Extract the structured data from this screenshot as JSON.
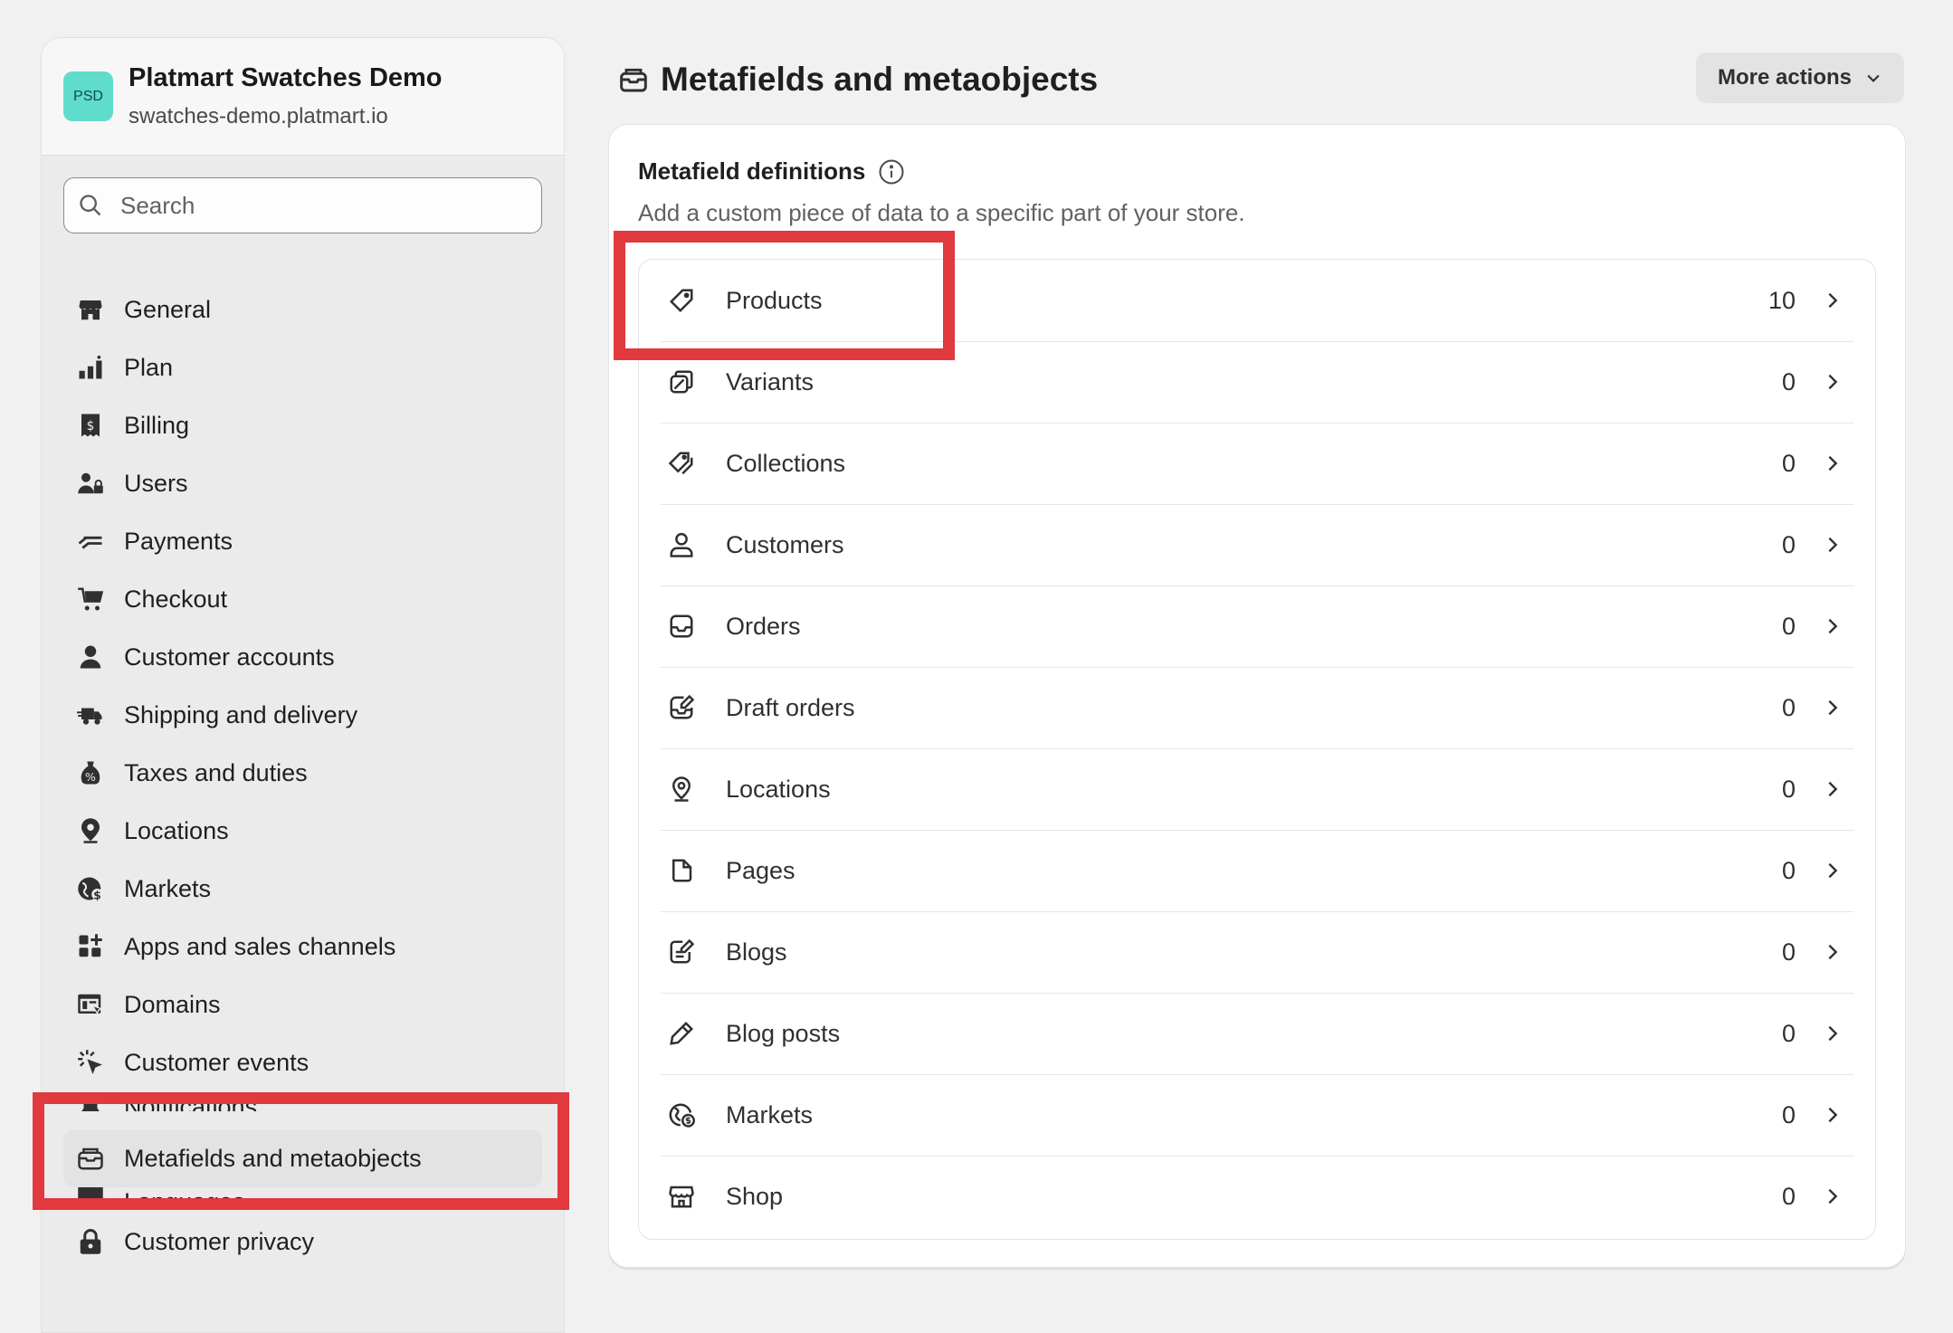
{
  "store": {
    "avatar_text": "PSD",
    "name": "Platmart Swatches Demo",
    "url": "swatches-demo.platmart.io"
  },
  "search": {
    "placeholder": "Search"
  },
  "sidebar": {
    "items": [
      {
        "label": "General",
        "icon": "store-icon"
      },
      {
        "label": "Plan",
        "icon": "plan-icon"
      },
      {
        "label": "Billing",
        "icon": "billing-icon"
      },
      {
        "label": "Users",
        "icon": "users-icon"
      },
      {
        "label": "Payments",
        "icon": "payments-icon"
      },
      {
        "label": "Checkout",
        "icon": "cart-icon"
      },
      {
        "label": "Customer accounts",
        "icon": "person-icon"
      },
      {
        "label": "Shipping and delivery",
        "icon": "truck-icon"
      },
      {
        "label": "Taxes and duties",
        "icon": "tax-icon"
      },
      {
        "label": "Locations",
        "icon": "location-pin-icon"
      },
      {
        "label": "Markets",
        "icon": "globe-icon"
      },
      {
        "label": "Apps and sales channels",
        "icon": "apps-icon"
      },
      {
        "label": "Domains",
        "icon": "domains-icon"
      },
      {
        "label": "Customer events",
        "icon": "cursor-click-icon"
      },
      {
        "label": "Notifications",
        "icon": "bell-icon"
      },
      {
        "label": "Metafields and metaobjects",
        "icon": "metafields-icon",
        "active": true
      },
      {
        "label": "Languages",
        "icon": "languages-icon"
      },
      {
        "label": "Customer privacy",
        "icon": "lock-icon"
      }
    ]
  },
  "header": {
    "title": "Metafields and metaobjects",
    "more_actions_label": "More actions"
  },
  "card": {
    "heading": "Metafield definitions",
    "subtitle": "Add a custom piece of data to a specific part of your store.",
    "rows": [
      {
        "label": "Products",
        "count": "10",
        "icon": "tag-icon"
      },
      {
        "label": "Variants",
        "count": "0",
        "icon": "variants-icon"
      },
      {
        "label": "Collections",
        "count": "0",
        "icon": "collections-icon"
      },
      {
        "label": "Customers",
        "count": "0",
        "icon": "customer-icon"
      },
      {
        "label": "Orders",
        "count": "0",
        "icon": "inbox-icon"
      },
      {
        "label": "Draft orders",
        "count": "0",
        "icon": "draft-order-icon"
      },
      {
        "label": "Locations",
        "count": "0",
        "icon": "location-pin-icon"
      },
      {
        "label": "Pages",
        "count": "0",
        "icon": "page-icon"
      },
      {
        "label": "Blogs",
        "count": "0",
        "icon": "blog-icon"
      },
      {
        "label": "Blog posts",
        "count": "0",
        "icon": "pencil-icon"
      },
      {
        "label": "Markets",
        "count": "0",
        "icon": "globe-icon"
      },
      {
        "label": "Shop",
        "count": "0",
        "icon": "store-icon"
      }
    ]
  },
  "colors": {
    "highlight": "#e0393e",
    "avatar_bg": "#5fdccc",
    "page_bg": "#f1f1f1"
  }
}
